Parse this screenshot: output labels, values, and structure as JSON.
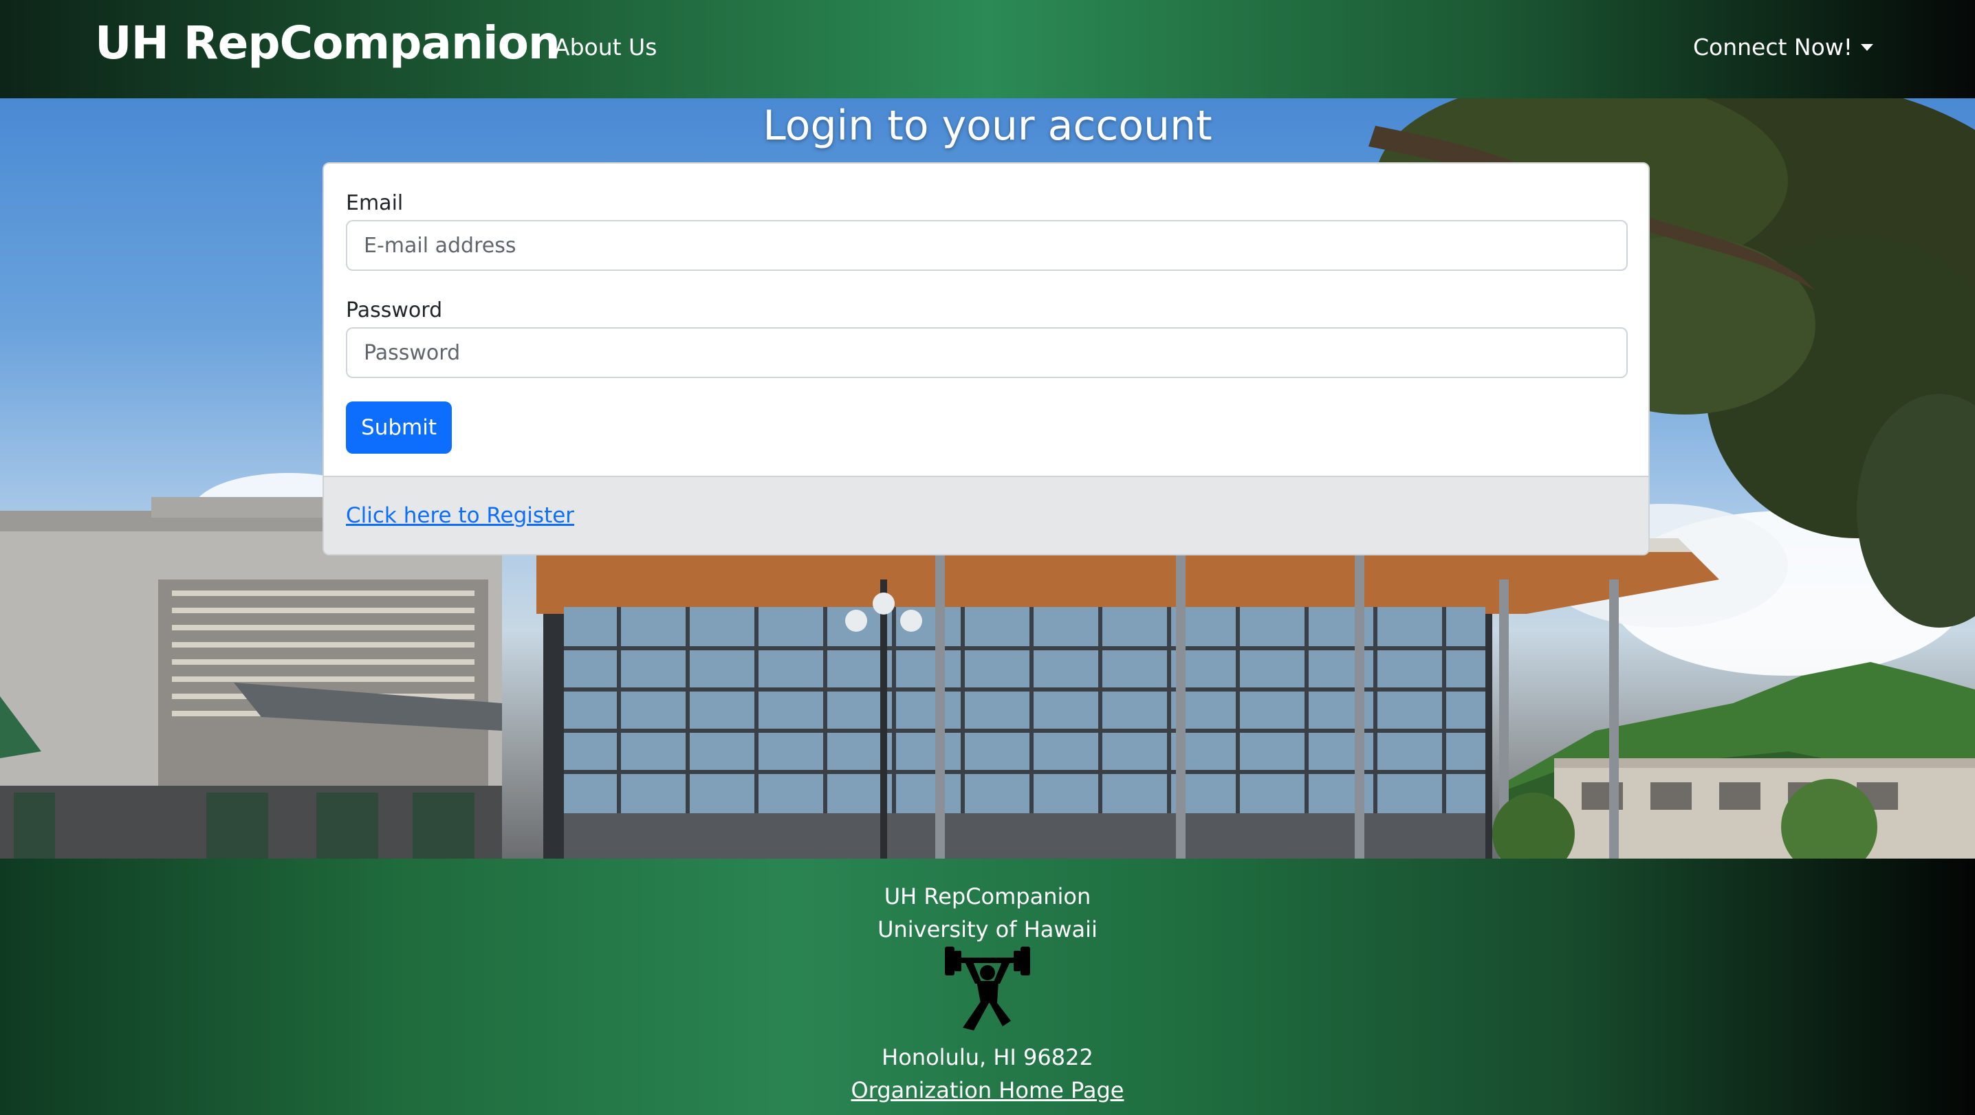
{
  "navbar": {
    "brand": "UH RepCompanion",
    "about_label": "About Us",
    "connect_label": "Connect Now!"
  },
  "login": {
    "title": "Login to your account",
    "email_label": "Email",
    "email_placeholder": "E-mail address",
    "email_value": "",
    "password_label": "Password",
    "password_placeholder": "Password",
    "password_value": "",
    "submit_label": "Submit",
    "register_link": "Click here to Register"
  },
  "footer": {
    "line1": "UH RepCompanion",
    "line2": "University of Hawaii",
    "logo_icon": "weightlifter-icon",
    "address": "Honolulu, HI 96822",
    "home_link": "Organization Home Page"
  },
  "colors": {
    "primary_button": "#0d6efd",
    "link": "#0d6efd",
    "nav_green": "#2b8a55"
  }
}
